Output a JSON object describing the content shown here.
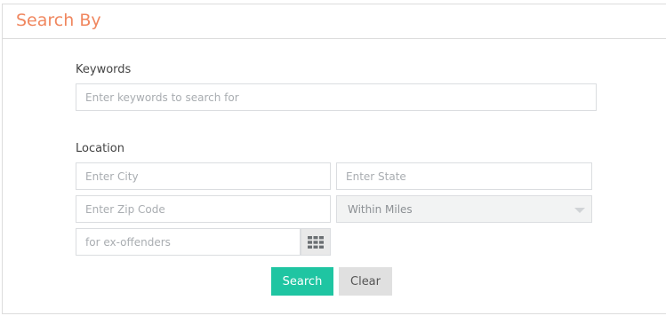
{
  "panel": {
    "title": "Search By"
  },
  "keywords": {
    "label": "Keywords",
    "placeholder": "Enter keywords to search for"
  },
  "location": {
    "label": "Location",
    "city_placeholder": "Enter City",
    "state_placeholder": "Enter State",
    "zip_placeholder": "Enter Zip Code",
    "within_miles": "Within Miles",
    "category_placeholder": "for ex-offenders"
  },
  "icons": {
    "grid": "grid-icon",
    "dropdown": "chevron-down-icon"
  },
  "buttons": {
    "search": "Search",
    "clear": "Clear"
  },
  "colors": {
    "title": "#f0875f",
    "search_button": "#1fc5a2",
    "clear_button": "#e0e0e0"
  }
}
